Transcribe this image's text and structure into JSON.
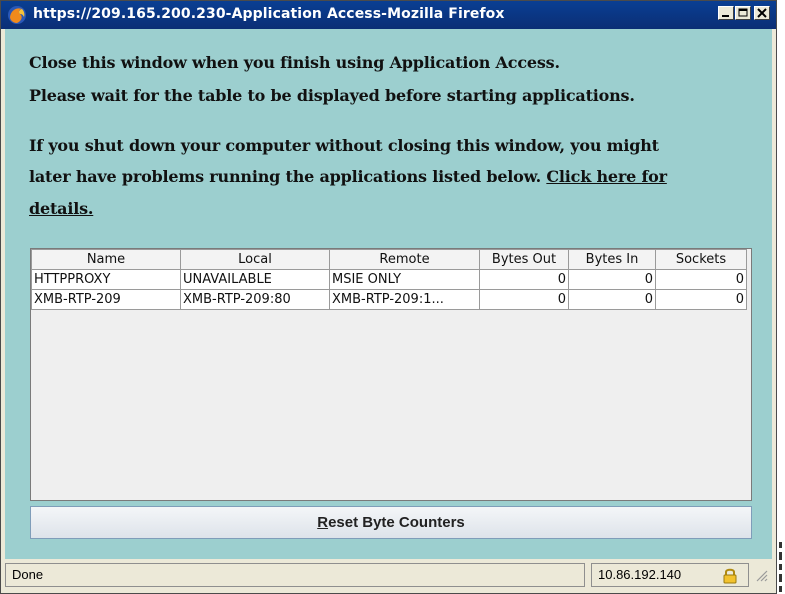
{
  "window": {
    "title": "https://209.165.200.230-Application Access-Mozilla Firefox",
    "icon": "firefox-icon",
    "controls": [
      "minimize-icon",
      "maximize-icon",
      "close-icon"
    ]
  },
  "messages": {
    "line1": "Close this window when you finish using Application Access.",
    "line2": "Please wait for the table to be displayed before starting applications.",
    "line3": "If you shut down your computer without closing this window, you might",
    "line4_prefix": "later have problems running the applications listed below. ",
    "link_part1": "Click here for",
    "link_part2": "details."
  },
  "table": {
    "columns": [
      "Name",
      "Local",
      "Remote",
      "Bytes Out",
      "Bytes In",
      "Sockets"
    ],
    "rows": [
      [
        "HTTPPROXY",
        "UNAVAILABLE",
        "MSIE ONLY",
        "0",
        "0",
        "0"
      ],
      [
        "XMB-RTP-209",
        "XMB-RTP-209:80",
        "XMB-RTP-209:1...",
        "0",
        "0",
        "0"
      ]
    ]
  },
  "reset_button": {
    "accel": "R",
    "rest": "eset Byte Counters"
  },
  "status": {
    "text": "Done",
    "ip": "10.86.192.140",
    "icon": "lock-icon"
  },
  "colors": {
    "titlebar": "#0a3f93",
    "content_bg": "#9ccfcf",
    "chrome": "#ece9d8"
  }
}
